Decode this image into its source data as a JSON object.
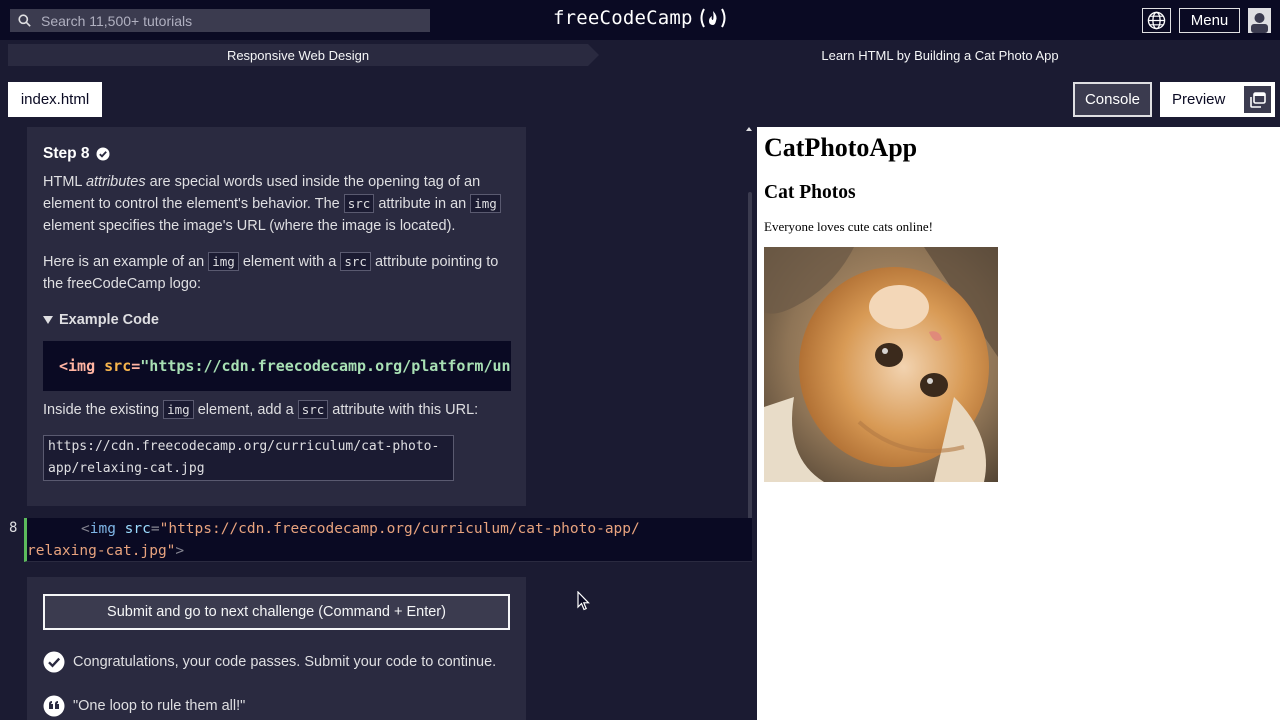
{
  "topnav": {
    "search_placeholder": "Search 11,500+ tutorials",
    "brand": "freeCodeCamp",
    "menu_label": "Menu"
  },
  "breadcrumb": {
    "superblock": "Responsive Web Design",
    "block": "Learn HTML by Building a Cat Photo App"
  },
  "editor_tabs": {
    "file": "index.html",
    "console": "Console",
    "preview": "Preview"
  },
  "instructions": {
    "step_title": "Step 8",
    "p1_a": "HTML ",
    "p1_em": "attributes",
    "p1_b": " are special words used inside the opening tag of an element to control the element's behavior. The ",
    "p1_code1": "src",
    "p1_c": " attribute in an ",
    "p1_code2": "img",
    "p1_d": " element specifies the image's URL (where the image is located).",
    "p2_a": "Here is an example of an ",
    "p2_code1": "img",
    "p2_b": " element with a ",
    "p2_code2": "src",
    "p2_c": " attribute pointing to the freeCodeCamp logo:",
    "example_label": "Example Code",
    "example_tag_open": "<img ",
    "example_attr": "src",
    "example_eq": "=",
    "example_str": "\"https://cdn.freecodecamp.org/platform/universal/fcc_primary.svg\"",
    "p3_a": "Inside the existing ",
    "p3_code1": "img",
    "p3_b": " element, add a ",
    "p3_code2": "src",
    "p3_c": " attribute with this URL:",
    "url": "https://cdn.freecodecamp.org/curriculum/cat-photo-app/relaxing-cat.jpg"
  },
  "editor": {
    "line_number": "8",
    "lt": "<",
    "tag": "img",
    "attr": "src",
    "eq": "=",
    "str_line1": "\"https://cdn.freecodecamp.org/curriculum/cat-photo-app/",
    "str_line2": "relaxing-cat.jpg\"",
    "gt": ">"
  },
  "lower_panel": {
    "submit_label": "Submit and go to next challenge (Command + Enter)",
    "pass_message": "Congratulations, your code passes. Submit your code to continue.",
    "quote": "\"One loop to rule them all!\""
  },
  "preview": {
    "h1": "CatPhotoApp",
    "h2": "Cat Photos",
    "p": "Everyone loves cute cats online!"
  },
  "colors": {
    "bg_dark": "#0a0a23",
    "bg_main": "#1b1b32",
    "panel": "#2a2a40",
    "pass_green": "#5cbb5c"
  }
}
